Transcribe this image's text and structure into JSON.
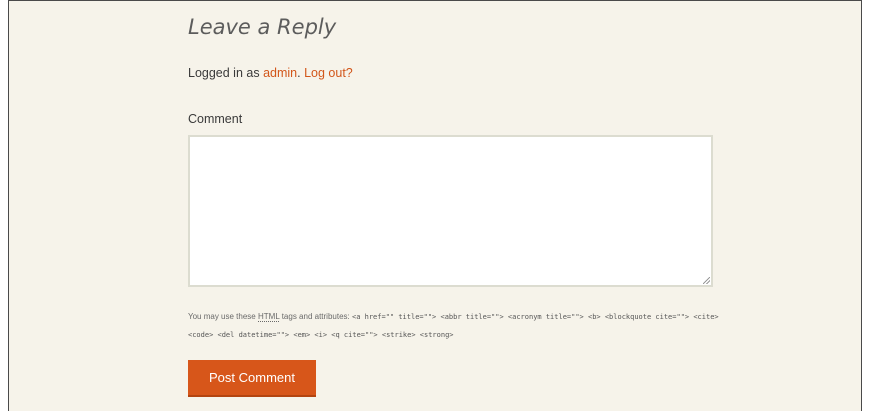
{
  "reply": {
    "title": "Leave a Reply",
    "logged_in_prefix": "Logged in as",
    "username": "admin",
    "separator": ".",
    "logout_label": "Log out?"
  },
  "form": {
    "comment_label": "Comment",
    "comment_value": "",
    "allowed_tags_prefix": "You may use these",
    "allowed_tags_abbr": "HTML",
    "allowed_tags_suffix": "tags and attributes:",
    "allowed_tags_list": "<a href=\"\" title=\"\"> <abbr title=\"\"> <acronym title=\"\"> <b> <blockquote cite=\"\"> <cite> <code> <del datetime=\"\"> <em> <i> <q cite=\"\"> <strike> <strong>",
    "submit_label": "Post Comment"
  },
  "colors": {
    "background": "#f6f3ea",
    "accent": "#d7561a",
    "link": "#d2561a"
  }
}
